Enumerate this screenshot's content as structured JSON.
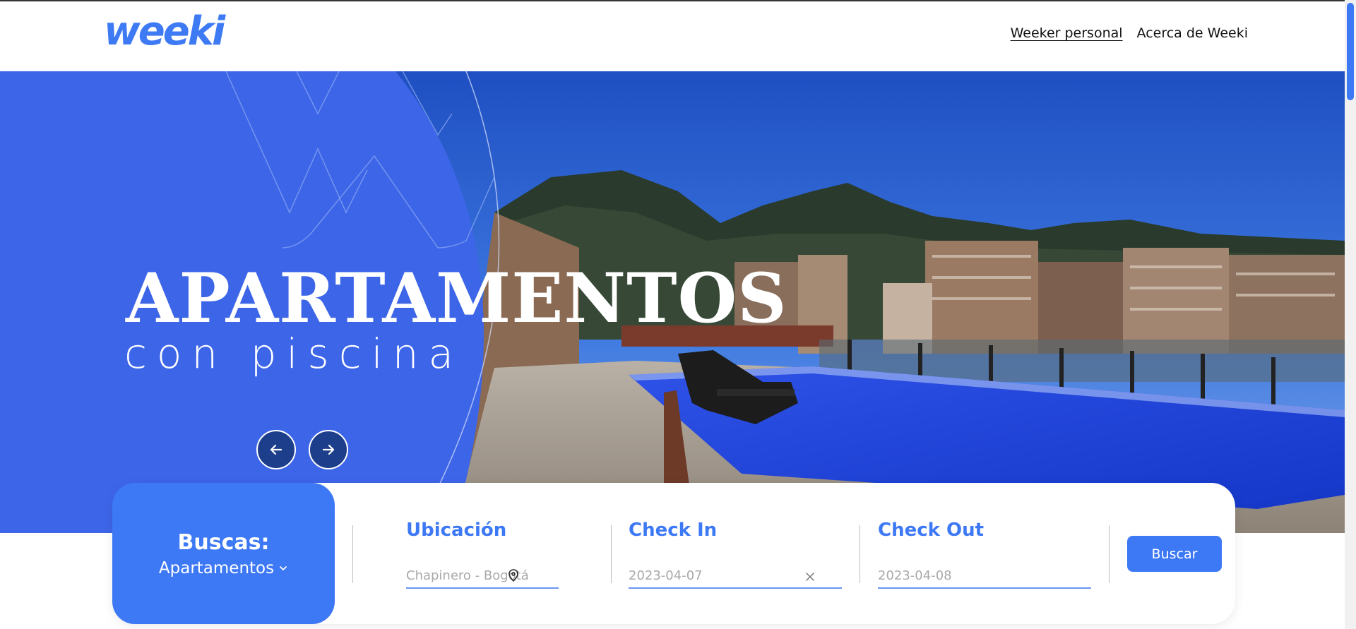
{
  "header": {
    "logo_text": "weeki",
    "nav": [
      {
        "label": "Weeker personal",
        "active": true
      },
      {
        "label": "Acerca de Weeki",
        "active": false
      }
    ]
  },
  "hero": {
    "title": "APARTAMENTOS",
    "subtitle": "con piscina"
  },
  "search": {
    "type_label": "Buscas:",
    "type_value": "Apartamentos",
    "location": {
      "label": "Ubicación",
      "value": "Chapinero - Bogotá"
    },
    "check_in": {
      "label": "Check In",
      "value": "2023-04-07"
    },
    "check_out": {
      "label": "Check Out",
      "value": "2023-04-08"
    },
    "button": "Buscar"
  },
  "colors": {
    "brand_blue": "#3d78f5",
    "arrow_dark": "#1d3e8a"
  },
  "icons": {
    "prev": "arrow-left-icon",
    "next": "arrow-right-icon",
    "type_dropdown": "chevron-down-icon",
    "location": "map-pin-icon",
    "clear_date": "close-icon"
  }
}
